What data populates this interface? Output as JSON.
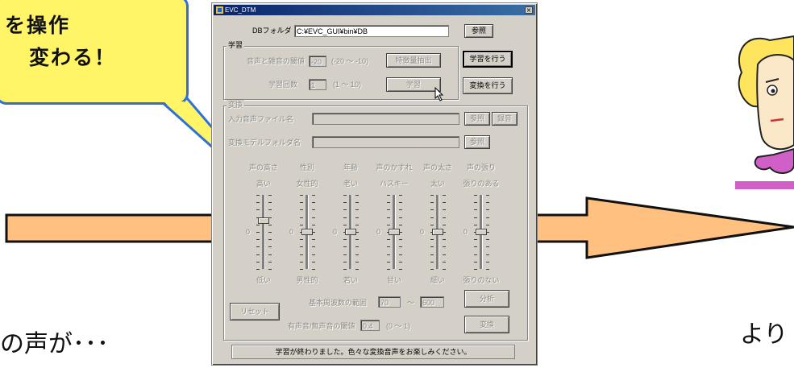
{
  "slide": {
    "callout_line1": "を操作",
    "callout_line2": "変わる！",
    "left_caption": "の声が･･･",
    "right_caption": "より"
  },
  "window": {
    "title": "EVC_DTM",
    "close_glyph": "×",
    "db_folder_label": "DBフォルダ",
    "db_folder_value": "C:¥EVC_GUI¥bin¥DB",
    "db_browse_button": "参照",
    "learn_group_title": "学習",
    "threshold_label": "音声と雑音の閾値",
    "threshold_value": "-20",
    "threshold_range": "(-20 ～ -10)",
    "feature_extract_button": "特徴量抽出",
    "learn_count_label": "学習回数",
    "learn_count_value": "1",
    "learn_count_range": "(1 ～ 10)",
    "learn_button": "学習",
    "do_learn_button": "学習を行う",
    "do_convert_button": "変換を行う",
    "convert_group_title": "変換",
    "input_file_label": "入力音声ファイル名",
    "input_browse_button": "参照",
    "record_button": "録音",
    "model_folder_label": "変換モデルフォルダ名",
    "model_browse_button": "参照",
    "sliders": [
      {
        "name": "声の高さ",
        "top": "高い",
        "bottom": "低い",
        "level": 0.65
      },
      {
        "name": "性別",
        "top": "女性的",
        "bottom": "男性的",
        "level": 0.5
      },
      {
        "name": "年齢",
        "top": "老い",
        "bottom": "若い",
        "level": 0.5
      },
      {
        "name": "声のかすれ",
        "top": "ハスキー",
        "bottom": "甘い",
        "level": 0.5
      },
      {
        "name": "声の太さ",
        "top": "太い",
        "bottom": "細い",
        "level": 0.5
      },
      {
        "name": "声の張り",
        "top": "張りのある",
        "bottom": "張りのない",
        "level": 0.5
      }
    ],
    "zero_label": "0",
    "reset_button": "リセット",
    "f0_range_label": "基本周波数の範囲",
    "f0_min": "70",
    "f0_tilde": "～",
    "f0_max": "600",
    "analyze_button": "分析",
    "vuv_label": "有声音/無声音の閾値",
    "vuv_value": "0.4",
    "vuv_range": "(0 ～ 1)",
    "convert_button": "変換",
    "status_text": "学習が終わりました。色々な変換音声をお楽しみください。"
  },
  "colors": {
    "arrow_fill": "#ffc080",
    "callout_fill": "#fff566",
    "callout_border": "#2f6fdc",
    "window_face": "#d4d0c8",
    "title_bar": "#0a246a"
  }
}
